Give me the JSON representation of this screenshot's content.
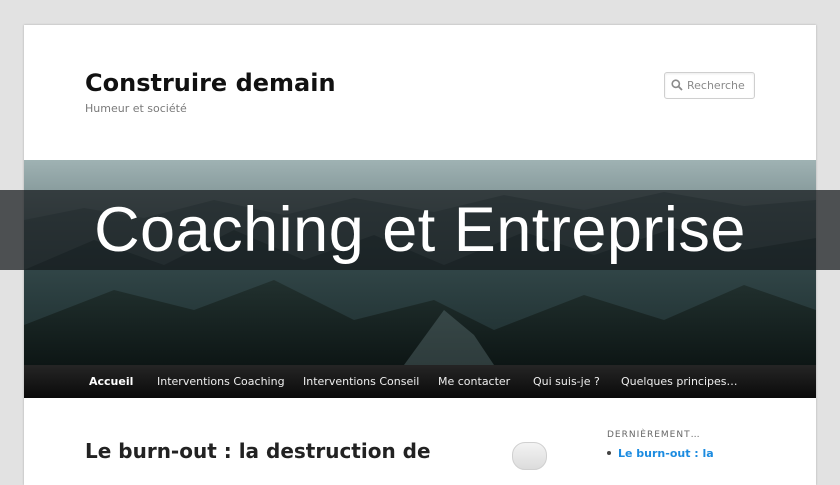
{
  "site": {
    "title": "Construire demain",
    "tagline": "Humeur et société"
  },
  "search": {
    "placeholder": "Recherche",
    "icon": "magnifier-icon"
  },
  "banner": {
    "text": "Coaching et Entreprise"
  },
  "nav": {
    "items": [
      {
        "label": "Accueil",
        "active": true
      },
      {
        "label": "Interventions Coaching",
        "active": false
      },
      {
        "label": "Interventions Conseil",
        "active": false
      },
      {
        "label": "Me contacter",
        "active": false
      },
      {
        "label": "Qui suis-je ?",
        "active": false
      },
      {
        "label": "Quelques principes…",
        "active": false
      }
    ]
  },
  "post": {
    "title": "Le burn-out : la destruction de"
  },
  "sidebar": {
    "widget_title": "DERNIÈREMENT…",
    "items": [
      {
        "label": "Le burn-out : la"
      }
    ]
  },
  "colors": {
    "page_background": "#e2e2e2",
    "nav_background": "#111111",
    "link": "#1b8be0",
    "banner_overlay": "#14181a"
  }
}
